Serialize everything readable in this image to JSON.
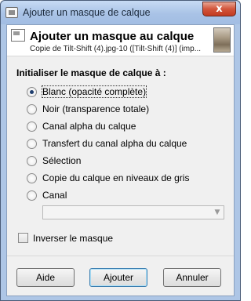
{
  "window": {
    "title": "Ajouter un masque de calque",
    "close_label": "x"
  },
  "header": {
    "title": "Ajouter un masque au calque",
    "subtitle": "Copie de Tilt-Shift (4).jpg-10 ([Tilt-Shift (4)] (imp..."
  },
  "section_title": "Initialiser le masque de calque à :",
  "options": [
    {
      "label": "Blanc (opacité complète)",
      "checked": true
    },
    {
      "label": "Noir (transparence totale)",
      "checked": false
    },
    {
      "label": "Canal alpha du calque",
      "checked": false
    },
    {
      "label": "Transfert du canal alpha du calque",
      "checked": false
    },
    {
      "label": "Sélection",
      "checked": false
    },
    {
      "label": "Copie du calque en niveaux de gris",
      "checked": false
    },
    {
      "label": "Canal",
      "checked": false
    }
  ],
  "channel_combo": {
    "value": ""
  },
  "invert": {
    "label": "Inverser le masque",
    "checked": false
  },
  "buttons": {
    "help": "Aide",
    "add": "Ajouter",
    "cancel": "Annuler"
  }
}
